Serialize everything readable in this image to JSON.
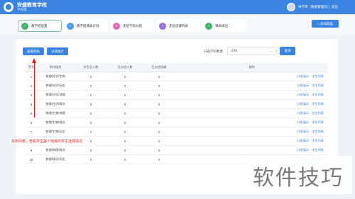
{
  "header": {
    "title": "安盛教育学校",
    "subtitle": "学校端",
    "user_label": "林学哥（数据管理员）",
    "logout": "退出"
  },
  "steps": [
    {
      "label": "教学班设置",
      "color": "#3fb36a",
      "active": true
    },
    {
      "label": "教学班课表计划",
      "color": "#4a9be8",
      "active": false
    },
    {
      "label": "走班学科分班",
      "color": "#e06fb3",
      "active": false
    },
    {
      "label": "走班选课列表",
      "color": "#9a6fe0",
      "active": false
    },
    {
      "label": "课表排出",
      "color": "#3fb36a",
      "active": false
    }
  ],
  "add_button": "+ 添加班级",
  "toolbar": {
    "view_list": "查看列表",
    "assign_class": "分班统计",
    "filter_label": "分班学科数量",
    "filter_value": "三科",
    "query": "查询"
  },
  "table": {
    "headers": [
      "序号",
      "学科组合",
      "学生总人数",
      "已分班人数",
      "已分班班级",
      "操作"
    ],
    "rows": [
      [
        "1",
        "物理/化学/生物",
        "0",
        "0",
        "0"
      ],
      [
        "2",
        "物理/化学/历史",
        "0",
        "0",
        "0"
      ],
      [
        "3",
        "物理/化学/地理",
        "0",
        "0",
        "0"
      ],
      [
        "4",
        "物理/化学/政治",
        "0",
        "0",
        "0"
      ],
      [
        "5",
        "物理/生物/地理",
        "0",
        "0",
        "0"
      ],
      [
        "6",
        "物理/生物/政治",
        "0",
        "0",
        "0"
      ],
      [
        "7",
        "物理/生物/历史",
        "0",
        "0",
        "0"
      ],
      [
        "8",
        "物理/历史/政治",
        "0",
        "0",
        "0"
      ],
      [
        "9",
        "物理/地理/政治",
        "0",
        "0",
        "0"
      ],
      [
        "10",
        "物理/政治/历史",
        "0",
        "0",
        "0"
      ]
    ],
    "op_links": [
      "分班展示",
      "学生列表"
    ]
  },
  "annotation": "找到列表，查看学生各个班级的学生选择情况",
  "watermark": "软件技巧"
}
